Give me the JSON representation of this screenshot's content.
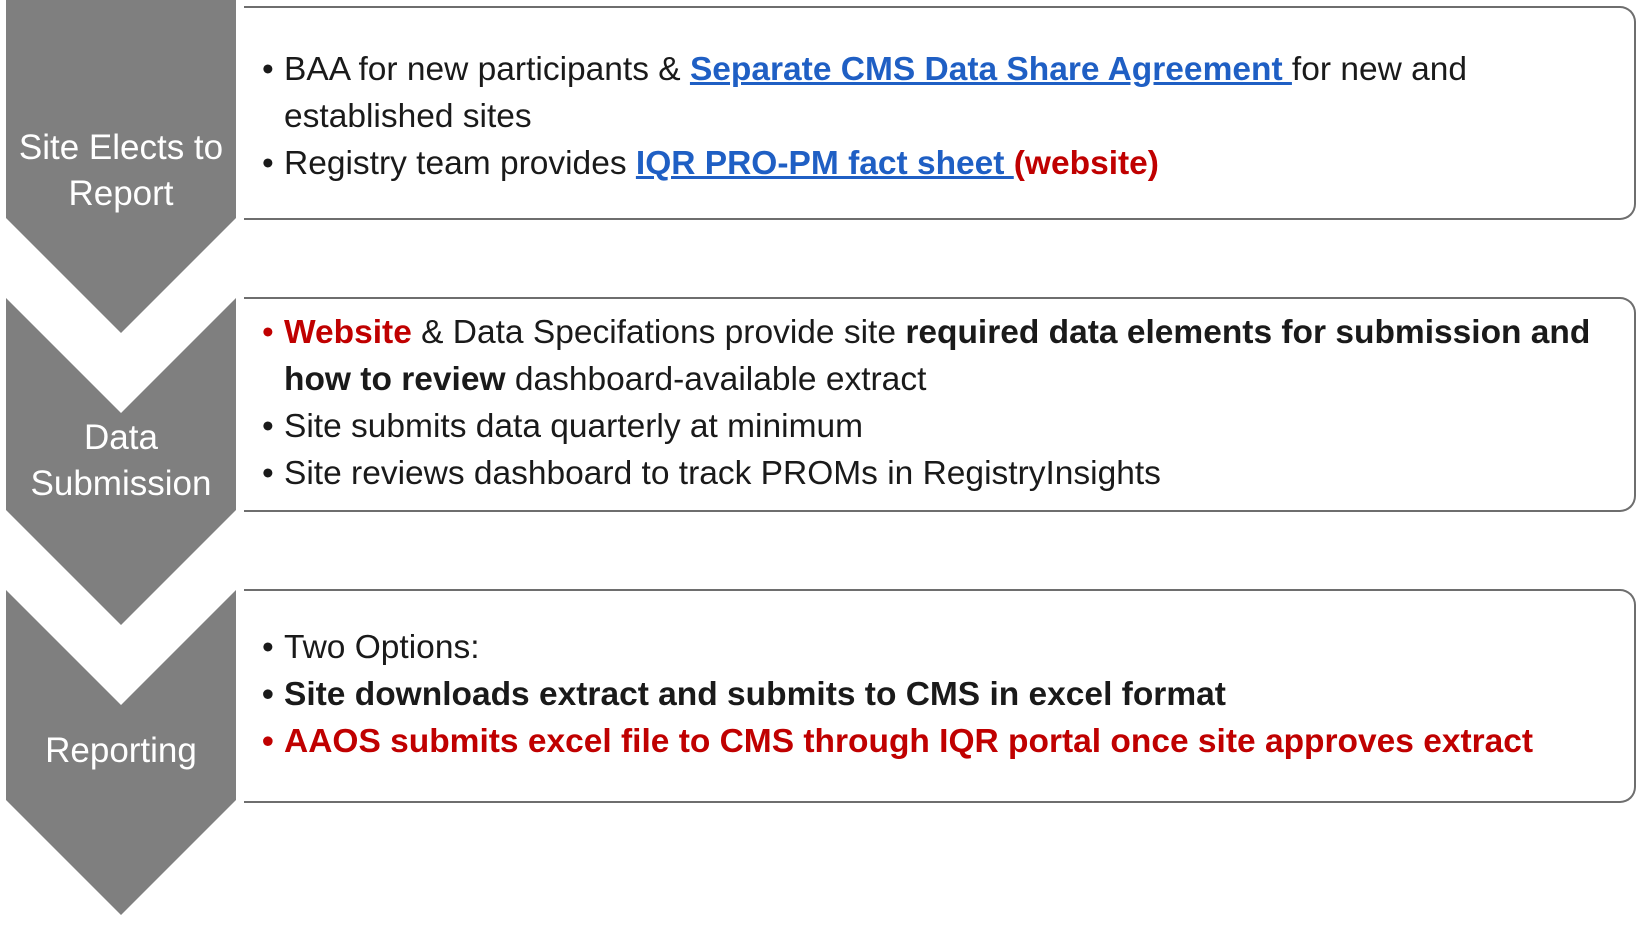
{
  "colors": {
    "chevron": "#7f7f7f",
    "panel_border": "#6e6e6e",
    "link": "#1f5fc4",
    "accent_red": "#c00000",
    "text": "#1a1a1a"
  },
  "steps": [
    {
      "label_line1": "Site Elects to",
      "label_line2": "Report",
      "bullet1": {
        "a": "BAA for new participants & ",
        "link": "Separate CMS Data Share Agreement ",
        "b": "for new and established sites"
      },
      "bullet2": {
        "a": "Registry team provides ",
        "link": "IQR PRO-PM fact sheet ",
        "red": "(website)"
      }
    },
    {
      "label_line1": "Data",
      "label_line2": "Submission",
      "bullet1": {
        "red": "Website",
        "a": " & Data Specifations provide site ",
        "bold": "required data elements for submission and how to review",
        "b": " dashboard-available extract"
      },
      "bullet2": "Site submits data quarterly at minimum",
      "bullet3": "Site reviews dashboard to track PROMs in RegistryInsights"
    },
    {
      "label": "Reporting",
      "bullet1": "Two Options:",
      "bullet2": "Site downloads extract and submits to CMS in excel format",
      "bullet3": "AAOS submits excel file to CMS through IQR portal once site approves extract"
    }
  ]
}
